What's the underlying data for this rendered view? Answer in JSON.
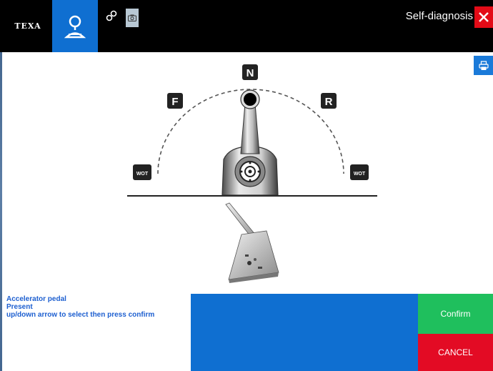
{
  "header": {
    "logo_text": "TEXA",
    "title": "Self-diagnosis"
  },
  "icons": {
    "diag_tab": "person-search-icon",
    "link": "link-chain-icon",
    "camera": "camera-icon",
    "close": "close-icon",
    "print": "printer-icon"
  },
  "diagram": {
    "label_neutral": "N",
    "label_forward": "F",
    "label_reverse": "R",
    "label_wot_left": "WOT",
    "label_wot_right": "WOT"
  },
  "info": {
    "line1": "Accelerator pedal",
    "line2": "Present",
    "line3": "up/down arrow to select then press confirm"
  },
  "buttons": {
    "confirm": "Confirm",
    "cancel": "CANCEL"
  },
  "colors": {
    "accent_blue": "#0f6fd1",
    "confirm_green": "#1fbf5d",
    "cancel_red": "#e30b24",
    "close_red": "#e30b17",
    "info_text": "#1d5fd0"
  }
}
